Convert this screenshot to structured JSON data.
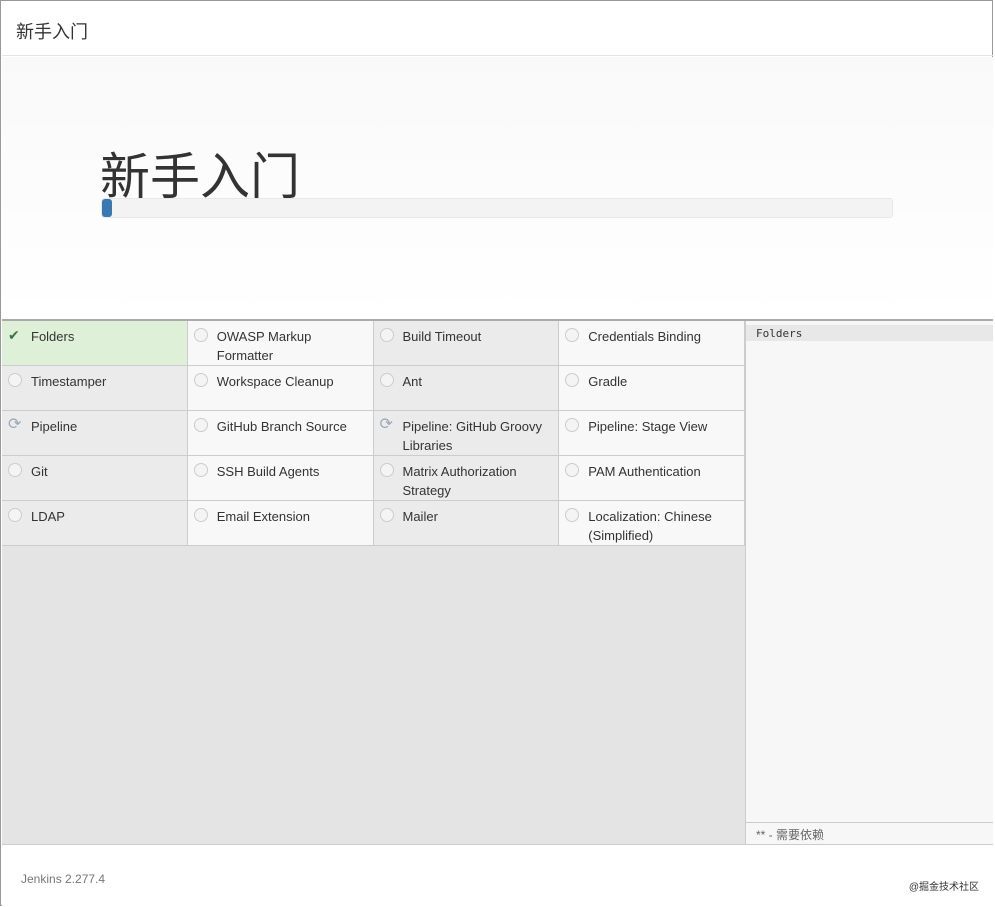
{
  "header": {
    "title": "新手入门"
  },
  "hero": {
    "title": "新手入门",
    "progress_percent": 1.3
  },
  "plugins": [
    {
      "name": "Folders",
      "status": "success"
    },
    {
      "name": "OWASP Markup Formatter",
      "status": "pending"
    },
    {
      "name": "Build Timeout",
      "status": "pending"
    },
    {
      "name": "Credentials Binding",
      "status": "pending"
    },
    {
      "name": "Timestamper",
      "status": "pending"
    },
    {
      "name": "Workspace Cleanup",
      "status": "pending"
    },
    {
      "name": "Ant",
      "status": "pending"
    },
    {
      "name": "Gradle",
      "status": "pending"
    },
    {
      "name": "Pipeline",
      "status": "installing"
    },
    {
      "name": "GitHub Branch Source",
      "status": "pending"
    },
    {
      "name": "Pipeline: GitHub Groovy Libraries",
      "status": "installing"
    },
    {
      "name": "Pipeline: Stage View",
      "status": "pending"
    },
    {
      "name": "Git",
      "status": "pending"
    },
    {
      "name": "SSH Build Agents",
      "status": "pending"
    },
    {
      "name": "Matrix Authorization Strategy",
      "status": "pending"
    },
    {
      "name": "PAM Authentication",
      "status": "pending"
    },
    {
      "name": "LDAP",
      "status": "pending"
    },
    {
      "name": "Email Extension",
      "status": "pending"
    },
    {
      "name": "Mailer",
      "status": "pending"
    },
    {
      "name": "Localization: Chinese (Simplified)",
      "status": "pending"
    }
  ],
  "log": {
    "lines": [
      "Folders"
    ],
    "legend": "** - 需要依赖"
  },
  "footer": {
    "version": "Jenkins 2.277.4",
    "watermark": "@掘金技术社区"
  },
  "colors": {
    "success": "#dff0d8",
    "accent": "#337ab7"
  }
}
